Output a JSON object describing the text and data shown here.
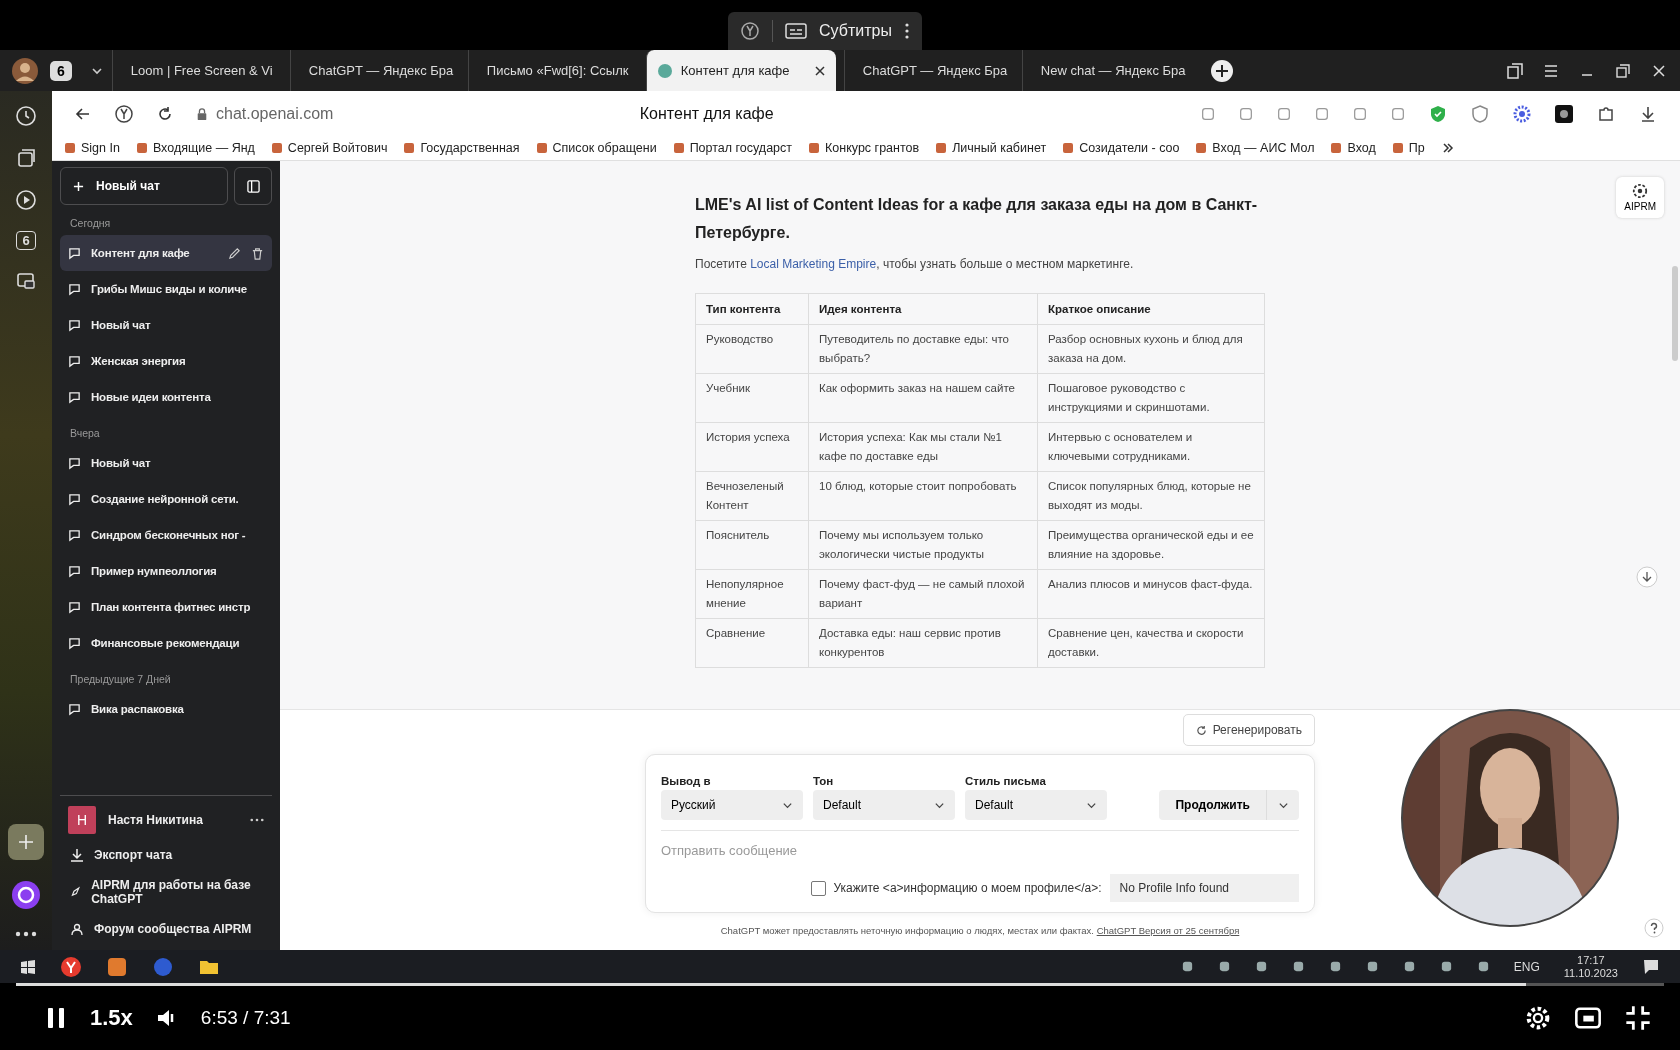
{
  "player_overlay": {
    "label": "Субтитры"
  },
  "browser": {
    "profile_badge": "6",
    "tabs": [
      {
        "title": "Loom | Free Screen & Vi",
        "selected": false
      },
      {
        "title": "ChatGPT — Яндекс Бра",
        "selected": false
      },
      {
        "title": "Письмо «Fwd[6]: Ссылк",
        "selected": false
      },
      {
        "title": "Контент для кафе",
        "selected": true
      },
      {
        "title": "ChatGPT — Яндекс Бра",
        "selected": false
      },
      {
        "title": "New chat — Яндекс Бра",
        "selected": false
      }
    ],
    "address": "chat.openai.com",
    "page_title": "Контент для кафе",
    "side_badge": "6",
    "bookmarks": [
      "Sign In",
      "Входящие — Янд",
      "Сергей Войтович",
      "Государственная",
      "Список обращени",
      "Портал государст",
      "Конкурс грантов",
      "Личный кабинет",
      "Созидатели - coo",
      "Вход — АИС Мол",
      "Вход",
      "Пр"
    ]
  },
  "sidebar": {
    "new_chat": "Новый чат",
    "groups": [
      {
        "label": "Сегодня",
        "items": [
          {
            "title": "Контент для кафе",
            "selected": true
          },
          {
            "title": "Грибы Мишс виды и количе",
            "selected": false
          },
          {
            "title": "Новый чат",
            "selected": false
          },
          {
            "title": "Женская энергия",
            "selected": false
          },
          {
            "title": "Новые идеи контента",
            "selected": false
          }
        ]
      },
      {
        "label": "Вчера",
        "items": [
          {
            "title": "Новый чат",
            "selected": false
          },
          {
            "title": "Создание нейронной сети.",
            "selected": false
          },
          {
            "title": "Синдром бесконечных ног -",
            "selected": false
          },
          {
            "title": "Пример нумпеоллогия",
            "selected": false
          },
          {
            "title": "План контента фитнес инстр",
            "selected": false
          },
          {
            "title": "Финансовые рекомендаци",
            "selected": false
          }
        ]
      },
      {
        "label": "Предыдущие 7 Дней",
        "items": [
          {
            "title": "Вика распаковка",
            "selected": false
          }
        ]
      }
    ],
    "user": {
      "initial": "Н",
      "name": "Настя Никитина"
    },
    "links": [
      {
        "kind": "export",
        "label": "Экспорт чата"
      },
      {
        "kind": "rocket",
        "label": "AIPRM для работы на базе ChatGPT"
      },
      {
        "kind": "forum",
        "label": "Форум сообщества AIPRM"
      }
    ]
  },
  "chat": {
    "aiprm_badge": "AIPRM",
    "heading": "LME's AI list of Content Ideas for a кафе для заказа еды на дом в Санкт-Петербурге.",
    "intro": {
      "before": "Посетите ",
      "link": "Local Marketing Empire",
      "after": ", чтобы узнать больше о местном маркетинге."
    },
    "table": {
      "columns": [
        "Тип контента",
        "Идея контента",
        "Краткое описание"
      ],
      "rows": [
        [
          "Руководство",
          "Путеводитель по доставке еды: что выбрать?",
          "Разбор основных кухонь и блюд для заказа на дом."
        ],
        [
          "Учебник",
          "Как оформить заказ на нашем сайте",
          "Пошаговое руководство с инструкциями и скриншотами."
        ],
        [
          "История успеха",
          "История успеха: Как мы стали №1 кафе по доставке еды",
          "Интервью с основателем и ключевыми сотрудниками."
        ],
        [
          "Вечнозеленый Контент",
          "10 блюд, которые стоит попробовать",
          "Список популярных блюд, которые не выходят из моды."
        ],
        [
          "Пояснитель",
          "Почему мы используем только экологически чистые продукты",
          "Преимущества органической еды и ее влияние на здоровье."
        ],
        [
          "Непопулярное мнение",
          "Почему фаст-фуд — не самый плохой вариант",
          "Анализ плюсов и минусов фаст-фуда."
        ],
        [
          "Сравнение",
          "Доставка еды: наш сервис против конкурентов",
          "Сравнение цен, качества и скорости доставки."
        ]
      ]
    },
    "regenerate": "Регенерировать"
  },
  "composer": {
    "selects": [
      {
        "label": "Вывод в",
        "value": "Русский"
      },
      {
        "label": "Тон",
        "value": "Default"
      },
      {
        "label": "Стиль письма",
        "value": "Default"
      }
    ],
    "continue": "Продолжить",
    "placeholder": "Отправить сообщение",
    "profile": {
      "label": "Укажите <a>информацию о моем профиле</a>:",
      "checked": false,
      "value": "No Profile Info found"
    },
    "footer": {
      "text": "ChatGPT может предоставлять неточную информацию о людях, местах или фактах.",
      "link": "ChatGPT Версия от 25 сентября"
    }
  },
  "taskbar": {
    "lang": "ENG",
    "time": "17:17",
    "date": "11.10.2023"
  },
  "player": {
    "playing": true,
    "level": 0.916,
    "speed": "1.5x",
    "time": "6:53 / 7:31"
  }
}
